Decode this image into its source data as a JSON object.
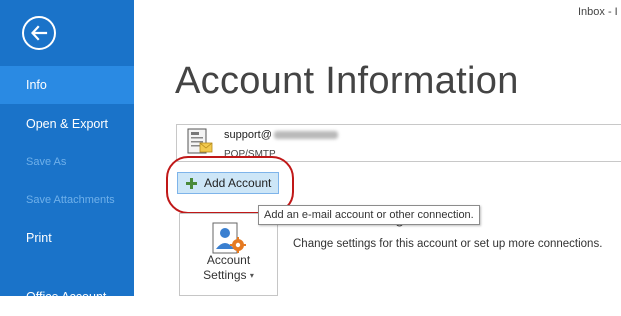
{
  "window": {
    "title": "Inbox - I"
  },
  "sidebar": {
    "items": [
      {
        "label": "Info",
        "selected": true,
        "disabled": false
      },
      {
        "label": "Open & Export",
        "selected": false,
        "disabled": false
      },
      {
        "label": "Save As",
        "selected": false,
        "disabled": true
      },
      {
        "label": "Save Attachments",
        "selected": false,
        "disabled": true
      },
      {
        "label": "Print",
        "selected": false,
        "disabled": false
      },
      {
        "label": "Office Account",
        "selected": false,
        "disabled": false
      }
    ]
  },
  "main": {
    "title": "Account Information",
    "account": {
      "email_prefix": "support@",
      "type": "POP/SMTP"
    },
    "add_account_label": "Add Account",
    "tooltip": "Add an e-mail account or other connection.",
    "account_settings": {
      "tile_line1": "Account",
      "tile_line2": "Settings",
      "heading": "Account Settings",
      "description": "Change settings for this account or set up more connections."
    }
  },
  "colors": {
    "sidebar_bg": "#1a73c9",
    "selected_item_bg": "#2a8ae3",
    "highlight_ring": "#c01818",
    "button_bg": "#cde6f7"
  },
  "icons": {
    "back": "back-arrow-icon",
    "account": "account-card-icon",
    "add": "plus-icon",
    "settings": "account-settings-icon"
  }
}
